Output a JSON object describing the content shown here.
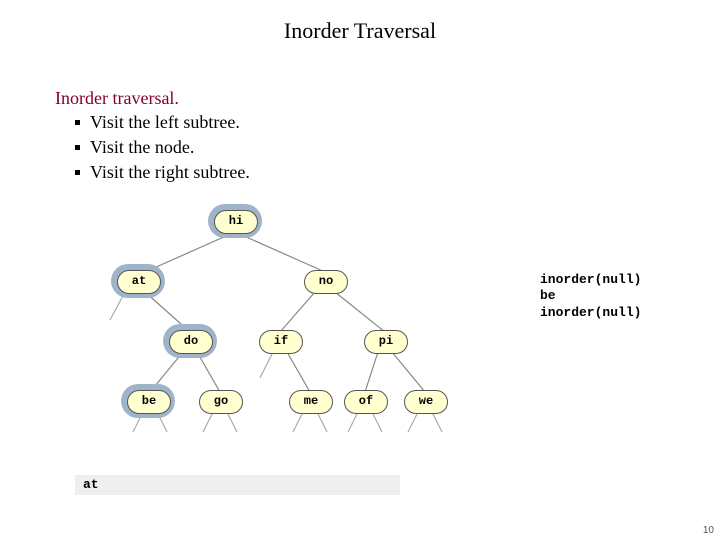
{
  "title": "Inorder Traversal",
  "lead": "Inorder traversal.",
  "bullets": [
    "Visit the left subtree.",
    "Visit the node.",
    "Visit the right subtree."
  ],
  "nodes": {
    "hi": "hi",
    "at": "at",
    "no": "no",
    "do": "do",
    "if": "if",
    "pi": "pi",
    "be": "be",
    "go": "go",
    "me": "me",
    "of": "of",
    "we": "we"
  },
  "sidecode": "inorder(null)\nbe\ninorder(null)",
  "bottombar": "at",
  "pagenum": "10"
}
